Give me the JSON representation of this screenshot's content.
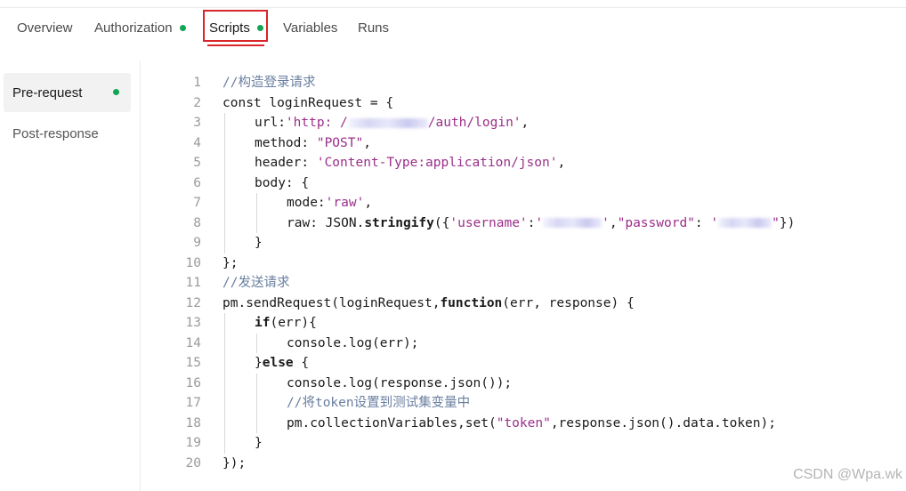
{
  "tabs": [
    {
      "label": "Overview",
      "dot": false
    },
    {
      "label": "Authorization",
      "dot": true
    },
    {
      "label": "Scripts",
      "dot": true,
      "active": true
    },
    {
      "label": "Variables",
      "dot": false
    },
    {
      "label": "Runs",
      "dot": false
    }
  ],
  "sidebar": {
    "items": [
      {
        "label": "Pre-request",
        "active": true,
        "dot": true
      },
      {
        "label": "Post-response",
        "active": false,
        "dot": false
      }
    ]
  },
  "editor": {
    "line_numbers": [
      "1",
      "2",
      "3",
      "4",
      "5",
      "6",
      "7",
      "8",
      "9",
      "10",
      "11",
      "12",
      "13",
      "14",
      "15",
      "16",
      "17",
      "18",
      "19",
      "20"
    ],
    "lines": [
      {
        "indent": 0,
        "tokens": [
          {
            "t": "//构造登录请求",
            "c": "comment"
          }
        ]
      },
      {
        "indent": 0,
        "tokens": [
          {
            "t": "const loginRequest = {",
            "c": "kw"
          }
        ]
      },
      {
        "indent": 1,
        "tokens": [
          {
            "t": "url:",
            "c": "kw"
          },
          {
            "t": "'http: /",
            "c": "str"
          },
          {
            "blur": 90
          },
          {
            "t": "/auth/login'",
            "c": "str"
          },
          {
            "t": ",",
            "c": "kw"
          }
        ]
      },
      {
        "indent": 1,
        "tokens": [
          {
            "t": "method: ",
            "c": "kw"
          },
          {
            "t": "\"POST\"",
            "c": "str"
          },
          {
            "t": ",",
            "c": "kw"
          }
        ]
      },
      {
        "indent": 1,
        "tokens": [
          {
            "t": "header: ",
            "c": "kw"
          },
          {
            "t": "'Content-Type:application/json'",
            "c": "str"
          },
          {
            "t": ",",
            "c": "kw"
          }
        ]
      },
      {
        "indent": 1,
        "tokens": [
          {
            "t": "body: {",
            "c": "kw"
          }
        ]
      },
      {
        "indent": 2,
        "tokens": [
          {
            "t": "mode:",
            "c": "kw"
          },
          {
            "t": "'raw'",
            "c": "str"
          },
          {
            "t": ",",
            "c": "kw"
          }
        ]
      },
      {
        "indent": 2,
        "tokens": [
          {
            "t": "raw: JSON.",
            "c": "kw"
          },
          {
            "t": "stringify",
            "c": "fn"
          },
          {
            "t": "({",
            "c": "kw"
          },
          {
            "t": "'username'",
            "c": "str"
          },
          {
            "t": ":",
            "c": "kw"
          },
          {
            "t": "'",
            "c": "str"
          },
          {
            "blur": 66
          },
          {
            "t": "'",
            "c": "str"
          },
          {
            "t": ",",
            "c": "kw"
          },
          {
            "t": "\"password\"",
            "c": "str"
          },
          {
            "t": ": ",
            "c": "kw"
          },
          {
            "t": "'",
            "c": "str"
          },
          {
            "blur": 60
          },
          {
            "t": "\"",
            "c": "str"
          },
          {
            "t": "})",
            "c": "kw"
          }
        ]
      },
      {
        "indent": 1,
        "tokens": [
          {
            "t": "}",
            "c": "kw"
          }
        ]
      },
      {
        "indent": 0,
        "tokens": [
          {
            "t": "};",
            "c": "kw"
          }
        ]
      },
      {
        "indent": 0,
        "tokens": [
          {
            "t": "//发送请求",
            "c": "comment"
          }
        ]
      },
      {
        "indent": 0,
        "tokens": [
          {
            "t": "pm.sendRequest(loginRequest,",
            "c": "kw"
          },
          {
            "t": "function",
            "c": "fn"
          },
          {
            "t": "(err, response) {",
            "c": "kw"
          }
        ]
      },
      {
        "indent": 1,
        "tokens": [
          {
            "t": "if",
            "c": "fn"
          },
          {
            "t": "(err){",
            "c": "kw"
          }
        ]
      },
      {
        "indent": 2,
        "tokens": [
          {
            "t": "console.log(err);",
            "c": "kw"
          }
        ]
      },
      {
        "indent": 1,
        "tokens": [
          {
            "t": "}",
            "c": "kw"
          },
          {
            "t": "else",
            "c": "fn"
          },
          {
            "t": " {",
            "c": "kw"
          }
        ]
      },
      {
        "indent": 2,
        "tokens": [
          {
            "t": "console.log(response.json());",
            "c": "kw"
          }
        ]
      },
      {
        "indent": 2,
        "tokens": [
          {
            "t": "//将token设置到测试集变量中",
            "c": "comment"
          }
        ]
      },
      {
        "indent": 2,
        "tokens": [
          {
            "t": "pm.collectionVariables,set(",
            "c": "kw"
          },
          {
            "t": "\"token\"",
            "c": "str"
          },
          {
            "t": ",response.json().data.token);",
            "c": "kw"
          }
        ]
      },
      {
        "indent": 1,
        "tokens": [
          {
            "t": "}",
            "c": "kw"
          }
        ]
      },
      {
        "indent": 0,
        "tokens": [
          {
            "t": "});",
            "c": "kw"
          }
        ]
      }
    ]
  },
  "watermark": "CSDN @Wpa.wk"
}
